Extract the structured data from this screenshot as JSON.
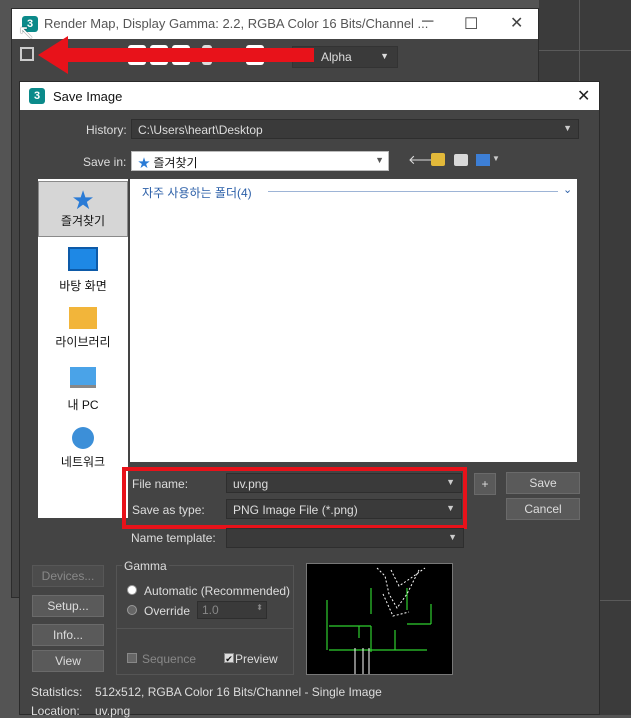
{
  "background_window": {
    "title": "Render Map, Display Gamma: 2.2, RGBA Color 16 Bits/Channel ...",
    "alpha_label": "Alpha"
  },
  "dialog": {
    "title": "Save Image",
    "history_label": "History:",
    "history_value": "C:\\Users\\heart\\Desktop",
    "save_in_label": "Save in:",
    "save_in_value": "즐겨찾기",
    "places": [
      {
        "label": "즐겨찾기",
        "icon": "star-icon"
      },
      {
        "label": "바탕 화면",
        "icon": "desktop-icon"
      },
      {
        "label": "라이브러리",
        "icon": "library-icon"
      },
      {
        "label": "내 PC",
        "icon": "computer-icon"
      },
      {
        "label": "네트워크",
        "icon": "network-icon"
      }
    ],
    "group_header": "자주 사용하는 폴더(4)",
    "file_name_label": "File name:",
    "file_name_value": "uv.png",
    "save_as_type_label": "Save as type:",
    "save_as_type_value": "PNG Image File (*.png)",
    "name_template_label": "Name template:",
    "name_template_value": "",
    "plus_label": "+",
    "save_button": "Save",
    "cancel_button": "Cancel",
    "devices_button": "Devices...",
    "setup_button": "Setup...",
    "info_button": "Info...",
    "view_button": "View",
    "gamma_title": "Gamma",
    "gamma_automatic": "Automatic (Recommended)",
    "gamma_override": "Override",
    "gamma_override_value": "1.0",
    "sequence_label": "Sequence",
    "preview_label": "Preview",
    "statistics_label": "Statistics:",
    "statistics_value": "512x512, RGBA Color 16 Bits/Channel - Single Image",
    "location_label": "Location:",
    "location_value": "uv.png"
  },
  "colors": {
    "highlight_red": "#e8121a",
    "dialog_bg": "#444444",
    "link_blue": "#2b5fa8"
  }
}
